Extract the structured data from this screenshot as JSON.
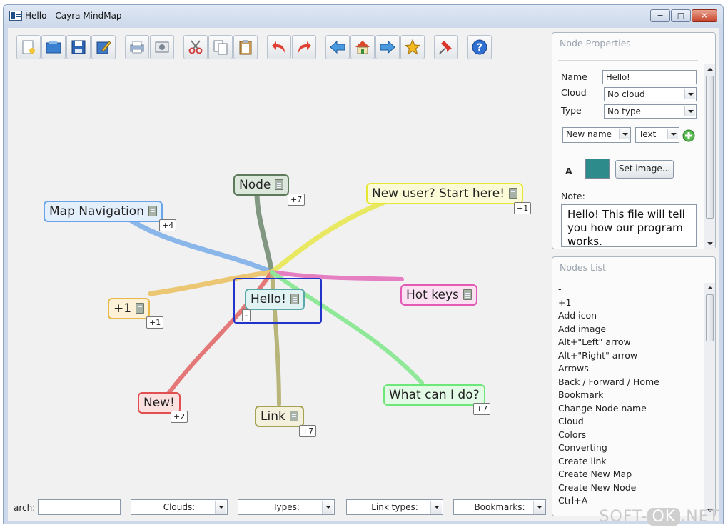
{
  "window": {
    "title": "Hello - Cayra MindMap"
  },
  "toolbar": {
    "buttons": [
      "new-icon",
      "open-icon",
      "save-icon",
      "edit-icon",
      "print-icon",
      "screenshot-icon",
      "cut-icon",
      "copy-icon",
      "paste-icon",
      "undo-icon",
      "redo-icon",
      "back-icon",
      "home-icon",
      "forward-icon",
      "star-icon",
      "pin-icon",
      "help-icon"
    ]
  },
  "map": {
    "center": {
      "label": "Hello!",
      "badge": "-"
    },
    "nodes": [
      {
        "id": "node",
        "label": "Node",
        "badge": "+7",
        "color": "#5d7a5d",
        "bg": "#dce8dc"
      },
      {
        "id": "new-user",
        "label": "New user? Start here!",
        "badge": "+1",
        "color": "#e6e634",
        "bg": "#fbfbd8"
      },
      {
        "id": "map-navigation",
        "label": "Map Navigation",
        "badge": "+4",
        "color": "#6aa3e8",
        "bg": "#e4effc"
      },
      {
        "id": "plus-one",
        "label": "+1",
        "badge": "+1",
        "color": "#e9b84a",
        "bg": "#fdf1d7"
      },
      {
        "id": "hot-keys",
        "label": "Hot keys",
        "badge": "",
        "color": "#e25ab3",
        "bg": "#fbe2f2"
      },
      {
        "id": "new",
        "label": "New!",
        "badge": "+2",
        "color": "#e05050",
        "bg": "#fbe0e0"
      },
      {
        "id": "link",
        "label": "Link",
        "badge": "+7",
        "color": "#a6a253",
        "bg": "#f3f1dc"
      },
      {
        "id": "what-can-i-do",
        "label": "What can I do?",
        "badge": "+7",
        "color": "#6ee67a",
        "bg": "#e3fbe6"
      }
    ]
  },
  "properties": {
    "title": "Node Properties",
    "name_label": "Name",
    "name_value": "Hello!",
    "cloud_label": "Cloud",
    "cloud_value": "No cloud",
    "type_label": "Type",
    "type_value": "No type",
    "new_name": "New name",
    "text": "Text",
    "font_label": "A",
    "swatch_color": "#2e8b8b",
    "set_image": "Set image...",
    "note_label": "Note:",
    "note_text": "Hello! This file will tell you how our program works."
  },
  "nodes_list": {
    "title": "Nodes List",
    "items": [
      "-",
      "+1",
      "Add icon",
      "Add image",
      "Alt+\"Left\" arrow",
      "Alt+\"Right\" arrow",
      "Arrows",
      "Back / Forward / Home",
      "Bookmark",
      "Change Node name",
      "Cloud",
      "Colors",
      "Converting",
      "Create link",
      "Create New Map",
      "Create New Node",
      "Ctrl+A"
    ]
  },
  "bottombar": {
    "search_label": "arch:",
    "clouds": "Clouds:",
    "types": "Types:",
    "link_types": "Link types:",
    "bookmarks": "Bookmarks:"
  },
  "watermark": {
    "a": "SOFT-",
    "b": "OK",
    "c": ".NET"
  }
}
